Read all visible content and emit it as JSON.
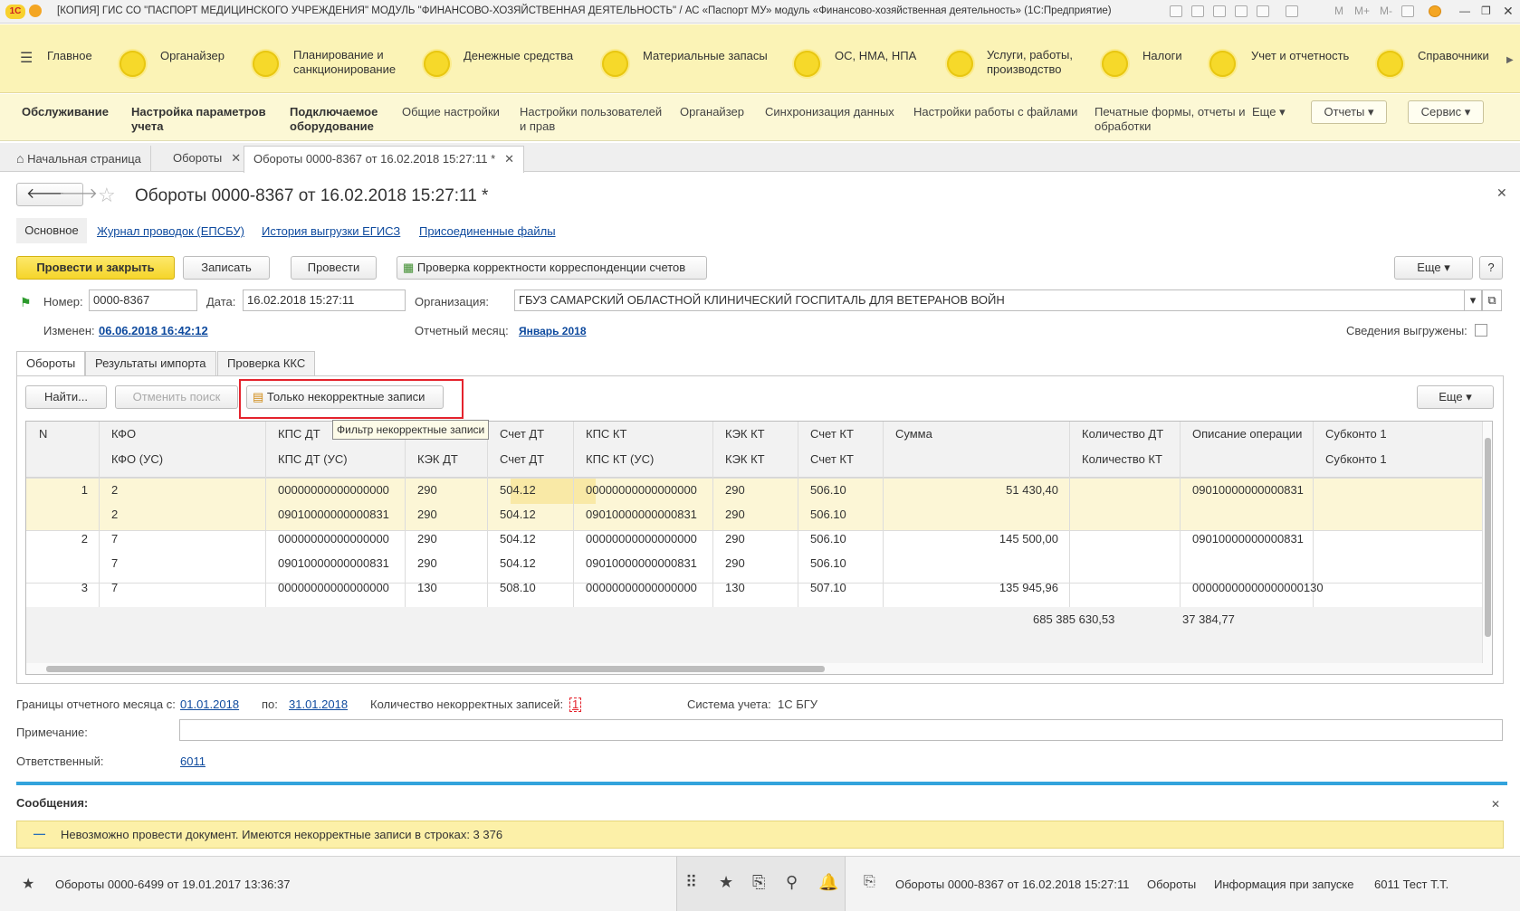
{
  "window": {
    "title": "[КОПИЯ] ГИС СО \"ПАСПОРТ МЕДИЦИНСКОГО УЧРЕЖДЕНИЯ\" МОДУЛЬ \"ФИНАНСОВО-ХОЗЯЙСТВЕННАЯ ДЕЯТЕЛЬНОСТЬ\" / АС «Паспорт МУ» модуль «Финансово-хозяйственная деятельность» (1С:Предприятие)",
    "logo": "1С",
    "btns": [
      "M",
      "M+",
      "M-"
    ]
  },
  "sections": {
    "main": "Главное",
    "items": [
      "Органайзер",
      "Планирование и санкционирование",
      "Денежные средства",
      "Материальные запасы",
      "ОС, НМА, НПА",
      "Услуги, работы, производство",
      "Налоги",
      "Учет и отчетность",
      "Справочники"
    ]
  },
  "commands": {
    "items": [
      "Обслуживание",
      "Настройка параметров учета",
      "Подключаемое оборудование",
      "Общие настройки",
      "Настройки пользователей и прав",
      "Органайзер",
      "Синхронизация данных",
      "Настройки работы с файлами",
      "Печатные формы, отчеты и обработки",
      "Еще"
    ],
    "reports": "Отчеты",
    "service": "Сервис"
  },
  "tabs": [
    "Начальная страница",
    "Обороты",
    "Обороты 0000-8367 от 16.02.2018 15:27:11 *"
  ],
  "form": {
    "title": "Обороты 0000-8367 от 16.02.2018 15:27:11 *",
    "nav": {
      "main": "Основное",
      "links": [
        "Журнал проводок (ЕПСБУ)",
        "История выгрузки ЕГИСЗ",
        "Присоединенные файлы"
      ]
    },
    "buttons": {
      "post_close": "Провести и закрыть",
      "write": "Записать",
      "post": "Провести",
      "check": "Проверка корректности корреспонденции счетов",
      "more": "Еще",
      "help": "?"
    },
    "number_label": "Номер:",
    "number": "0000-8367",
    "date_label": "Дата:",
    "date": "16.02.2018 15:27:11",
    "org_label": "Организация:",
    "org": "ГБУЗ САМАРСКИЙ ОБЛАСТНОЙ КЛИНИЧЕСКИЙ ГОСПИТАЛЬ ДЛЯ ВЕТЕРАНОВ ВОЙН",
    "changed_label": "Изменен:",
    "changed": "06.06.2018 16:42:12",
    "month_label": "Отчетный месяц:",
    "month": "Январь 2018",
    "exported_label": "Сведения выгружены:",
    "inner_tabs": [
      "Обороты",
      "Результаты импорта",
      "Проверка ККС"
    ],
    "find": "Найти...",
    "cancel_search": "Отменить поиск",
    "only_incorrect": "Только некорректные записи",
    "tooltip": "Фильтр некорректные записи",
    "more": "Еще"
  },
  "grid": {
    "h1": [
      "N",
      "КФО",
      "КПС ДТ",
      "",
      "Счет ДТ",
      "КПС КТ",
      "КЭК КТ",
      "Счет КТ",
      "Сумма",
      "Количество ДТ",
      "Описание операции",
      "Субконто 1"
    ],
    "h2": [
      "",
      "КФО (УС)",
      "КПС ДТ (УС)",
      "КЭК ДТ",
      "Счет ДТ",
      "КПС КТ (УС)",
      "КЭК КТ",
      "Счет КТ",
      "",
      "Количество КТ",
      "",
      "Субконто 1"
    ],
    "rows": [
      [
        "1",
        "2",
        "00000000000000000",
        "290",
        "504.12",
        "00000000000000000",
        "290",
        "506.10",
        "51 430,40",
        "",
        "09010000000000831",
        ""
      ],
      [
        "",
        "2",
        "09010000000000831",
        "290",
        "504.12",
        "09010000000000831",
        "290",
        "506.10",
        "",
        "",
        "",
        ""
      ],
      [
        "2",
        "7",
        "00000000000000000",
        "290",
        "504.12",
        "00000000000000000",
        "290",
        "506.10",
        "145 500,00",
        "",
        "09010000000000831",
        ""
      ],
      [
        "",
        "7",
        "09010000000000831",
        "290",
        "504.12",
        "09010000000000831",
        "290",
        "506.10",
        "",
        "",
        "",
        ""
      ],
      [
        "3",
        "7",
        "00000000000000000",
        "130",
        "508.10",
        "00000000000000000",
        "130",
        "507.10",
        "135 945,96",
        "",
        "00000000000000000130",
        ""
      ]
    ],
    "totals": {
      "sum": "685 385 630,53",
      "qty": "37 384,77"
    }
  },
  "bottom": {
    "bounds_label": "Границы отчетного месяца с:",
    "from": "01.01.2018",
    "to_label": "по:",
    "to": "31.01.2018",
    "incorrect_label": "Количество некорректных записей:",
    "incorrect": "1",
    "system_label": "Система учета:",
    "system": "1С БГУ",
    "note_label": "Примечание:",
    "resp_label": "Ответственный:",
    "resp": "6011"
  },
  "messages": {
    "title": "Сообщения:",
    "text": "Невозможно провести документ. Имеются некорректные записи в строках: 3 376"
  },
  "footer": {
    "left": "Обороты 0000-6499 от 19.01.2017 13:36:37",
    "right_doc": "Обороты 0000-8367 от 16.02.2018 15:27:11",
    "links": [
      "Обороты",
      "Информация при запуске",
      "6011 Тест Т.Т."
    ]
  },
  "colors": {
    "accent": "#f5d52a",
    "sections_bg": "#fbf3b6",
    "link": "#0e4a9e",
    "selection": "#fcf6d6",
    "highlight": "#e4232d",
    "divider": "#33a3dc"
  }
}
